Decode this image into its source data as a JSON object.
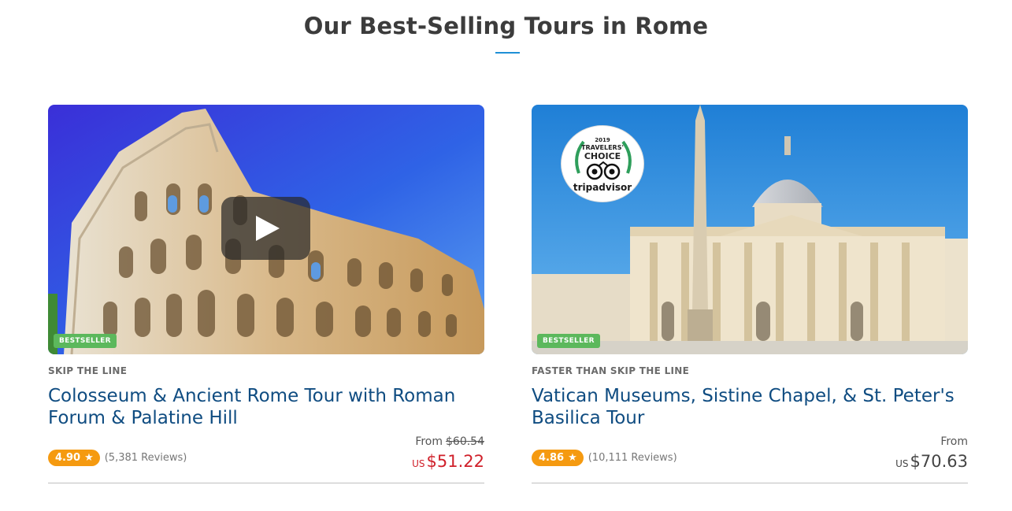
{
  "section": {
    "title": "Our Best-Selling Tours in Rome"
  },
  "tours": [
    {
      "badge": "BESTSELLER",
      "category": "SKIP THE LINE",
      "title": "Colosseum & Ancient Rome Tour with Roman Forum & Palatine Hill",
      "rating": "4.90",
      "reviews": "(5,381 Reviews)",
      "from_label": "From",
      "old_price": "$60.54",
      "currency": "US",
      "price": "$51.22",
      "has_video": true
    },
    {
      "badge": "BESTSELLER",
      "category": "FASTER THAN SKIP THE LINE",
      "title": "Vatican Museums, Sistine Chapel, & St. Peter's Basilica Tour",
      "rating": "4.86",
      "reviews": "(10,111 Reviews)",
      "from_label": "From",
      "currency": "US",
      "price": "$70.63",
      "award": {
        "year": "2019",
        "line1": "TRAVELERS'",
        "line2": "CHOICE",
        "brand": "tripadvisor"
      }
    }
  ],
  "colors": {
    "accent_blue": "#1e90d6",
    "title_blue": "#0f4c81",
    "rating_orange": "#f59a10",
    "badge_green": "#5cb85c",
    "sale_red": "#d0202a"
  },
  "icons": [
    "play-icon",
    "star-icon",
    "tripadvisor-owl-icon"
  ]
}
